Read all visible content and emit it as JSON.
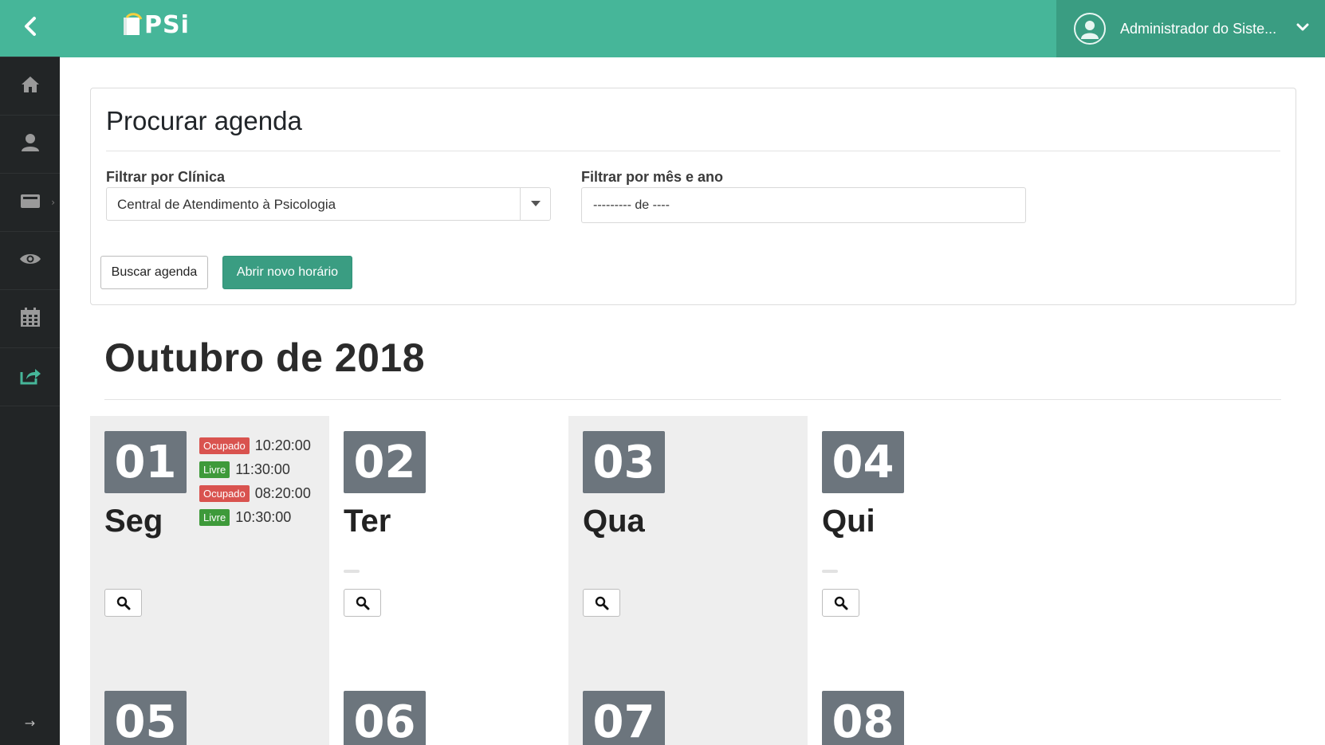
{
  "app": {
    "logo_text": "PSi"
  },
  "user": {
    "name": "Administrador do Siste..."
  },
  "sidebar": {
    "items": [
      {
        "icon": "home-icon"
      },
      {
        "icon": "user-icon"
      },
      {
        "icon": "inbox-icon"
      },
      {
        "icon": "eye-icon"
      },
      {
        "icon": "calendar-icon"
      },
      {
        "icon": "share-icon"
      }
    ]
  },
  "search_card": {
    "title": "Procurar agenda",
    "clinic_label": "Filtrar por Clínica",
    "clinic_value": "Central de Atendimento à Psicologia",
    "month_label": "Filtrar por mês e ano",
    "month_value": "--------- de ----",
    "search_button": "Buscar agenda",
    "new_button": "Abrir novo horário"
  },
  "calendar": {
    "month_title": "Outubro de 2018",
    "days": [
      {
        "num": "01",
        "name": "Seg",
        "slots": [
          {
            "status": "Ocupado",
            "time": "10:20:00"
          },
          {
            "status": "Livre",
            "time": "11:30:00"
          },
          {
            "status": "Ocupado",
            "time": "08:20:00"
          },
          {
            "status": "Livre",
            "time": "10:30:00"
          }
        ]
      },
      {
        "num": "02",
        "name": "Ter"
      },
      {
        "num": "03",
        "name": "Qua"
      },
      {
        "num": "04",
        "name": "Qui"
      },
      {
        "num": "05"
      },
      {
        "num": "06"
      },
      {
        "num": "07"
      },
      {
        "num": "08"
      }
    ]
  },
  "colors": {
    "accent": "#46b699",
    "accent_dark": "#3a9d82",
    "busy": "#d9534f",
    "free": "#3e9a3a",
    "day_badge": "#6c757d"
  }
}
